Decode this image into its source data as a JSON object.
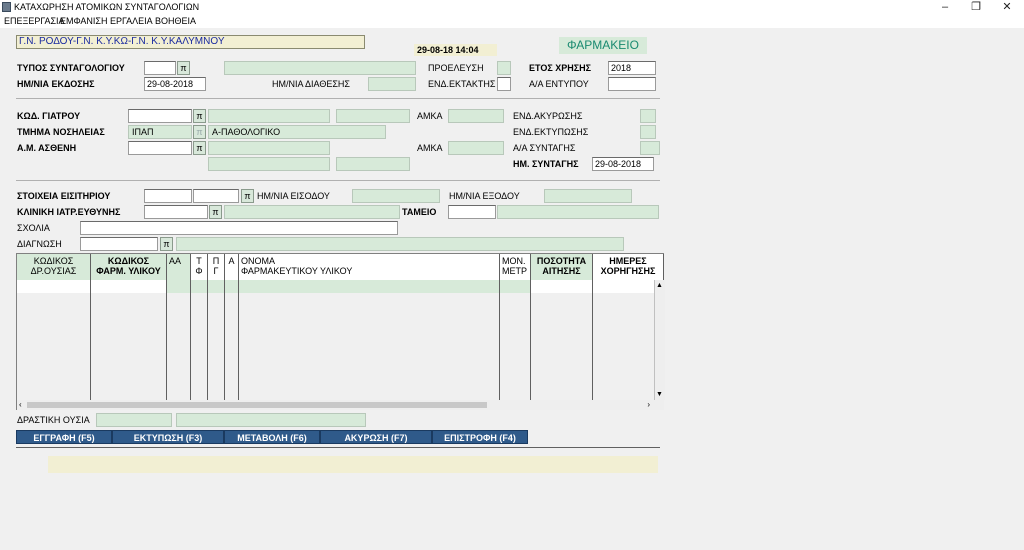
{
  "window": {
    "title": "ΚΑΤΑΧΩΡΗΣΗ ΑΤΟΜΙΚΩΝ ΣΥΝΤΑΓΟΛΟΓΙΩΝ",
    "minimize": "–",
    "maximize": "❐",
    "close": "✕"
  },
  "menu": [
    "ΕΠΕΞΕΡΓΑΣΙΑ",
    "ΕΜΦΑΝΙΣΗ",
    "ΕΡΓΑΛΕΙΑ",
    "ΒΟΗΘΕΙΑ"
  ],
  "header": {
    "org": "Γ.Ν. ΡΟΔΟΥ-Γ.Ν. Κ.Υ.ΚΩ-Γ.Ν. Κ.Υ.ΚΑΛΥΜΝΟΥ",
    "datetime": "29-08-18 14:04",
    "department": "ΦΑΡΜΑΚΕΙΟ"
  },
  "form": {
    "typos_label": "ΤΥΠΟΣ ΣΥΝΤΑΓΟΛΟΓΙΟΥ",
    "hm_ekdosis_label": "ΗΜ/ΝΙΑ ΕΚΔΟΣΗΣ",
    "hm_ekdosis_value": "29-08-2018",
    "hm_diathesis_label": "ΗΜ/ΝΙΑ ΔΙΑΘΕΣΗΣ",
    "proeleusi_label": "ΠΡΟΕΛΕΥΣΗ",
    "end_ektaktis_label": "ΕΝΔ.ΕΚΤΑΚΤΗΣ",
    "etos_label": "ΕΤΟΣ ΧΡΗΣΗΣ",
    "etos_value": "2018",
    "aa_entypou_label": "Α/Α ΕΝΤΥΠΟΥ",
    "kod_giatrou_label": "ΚΩΔ. ΓΙΑΤΡΟΥ",
    "tmima_label": "ΤΜΗΜΑ ΝΟΣΗΛΕΙΑΣ",
    "tmima_code": "ΙΠΑΠ",
    "tmima_name": "Α-ΠΑΘΟΛΟΓΙΚΟ",
    "am_astheni_label": "Α.Μ. ΑΣΘΕΝΗ",
    "amka_label": "ΑΜΚΑ",
    "amka2_label": "ΑΜΚΑ",
    "end_akyrosis_label": "ΕΝΔ.ΑΚΥΡΩΣΗΣ",
    "end_ektyposis_label": "ΕΝΔ.ΕΚΤΥΠΩΣΗΣ",
    "aa_syntagis_label": "Α/Α ΣΥΝΤΑΓΗΣ",
    "hm_syntagis_label": "ΗΜ. ΣΥΝΤΑΓΗΣ",
    "hm_syntagis_value": "29-08-2018",
    "stoixeia_label": "ΣΤΟΙΧΕΙΑ ΕΙΣΙΤΗΡΙΟΥ",
    "hm_eisodou_label": "ΗΜ/ΝΙΑ ΕΙΣΟΔΟΥ",
    "hm_exodou_label": "ΗΜ/ΝΙΑ ΕΞΟΔΟΥ",
    "kliniki_label": "ΚΛΙΝΙΚΗ ΙΑΤΡ.ΕΥΘΥΝΗΣ",
    "tameio_label": "ΤΑΜΕΙΟ",
    "sxolia_label": "ΣΧΟΛΙΑ",
    "diagnosi_label": "ΔΙΑΓΝΩΣΗ",
    "drastiki_label": "ΔΡΑΣΤΙΚΗ ΟΥΣΙΑ",
    "lookup": "π"
  },
  "grid": {
    "headers": [
      {
        "line1": "ΚΩΔΙΚΟΣ",
        "line2": "ΔΡ.ΟΥΣΙΑΣ"
      },
      {
        "line1": "ΚΩΔΙΚΟΣ",
        "line2": "ΦΑΡΜ. ΥΛΙΚΟΥ"
      },
      {
        "line1": "ΑΑ",
        "line2": ""
      },
      {
        "line1": "Τ",
        "line2": "Φ"
      },
      {
        "line1": "Π",
        "line2": "Γ"
      },
      {
        "line1": "Α",
        "line2": ""
      },
      {
        "line1": "ΟΝΟΜΑ",
        "line2": "ΦΑΡΜΑΚΕΥΤΙΚΟΥ ΥΛΙΚΟΥ"
      },
      {
        "line1": "ΜΟΝ.",
        "line2": "ΜΕΤΡ"
      },
      {
        "line1": "ΠΟΣΟΤΗΤΑ",
        "line2": "ΑΙΤΗΣΗΣ"
      },
      {
        "line1": "ΗΜΕΡΕΣ",
        "line2": "ΧΟΡΗΓΗΣΗΣ"
      }
    ]
  },
  "buttons": {
    "save": "ΕΓΓΡΑΦΗ (F5)",
    "print": "ΕΚΤΥΠΩΣΗ (F3)",
    "edit": "ΜΕΤΑΒΟΛΗ (F6)",
    "cancel": "ΑΚΥΡΩΣΗ (F7)",
    "back": "ΕΠΙΣΤΡΟΦΗ (F4)"
  }
}
